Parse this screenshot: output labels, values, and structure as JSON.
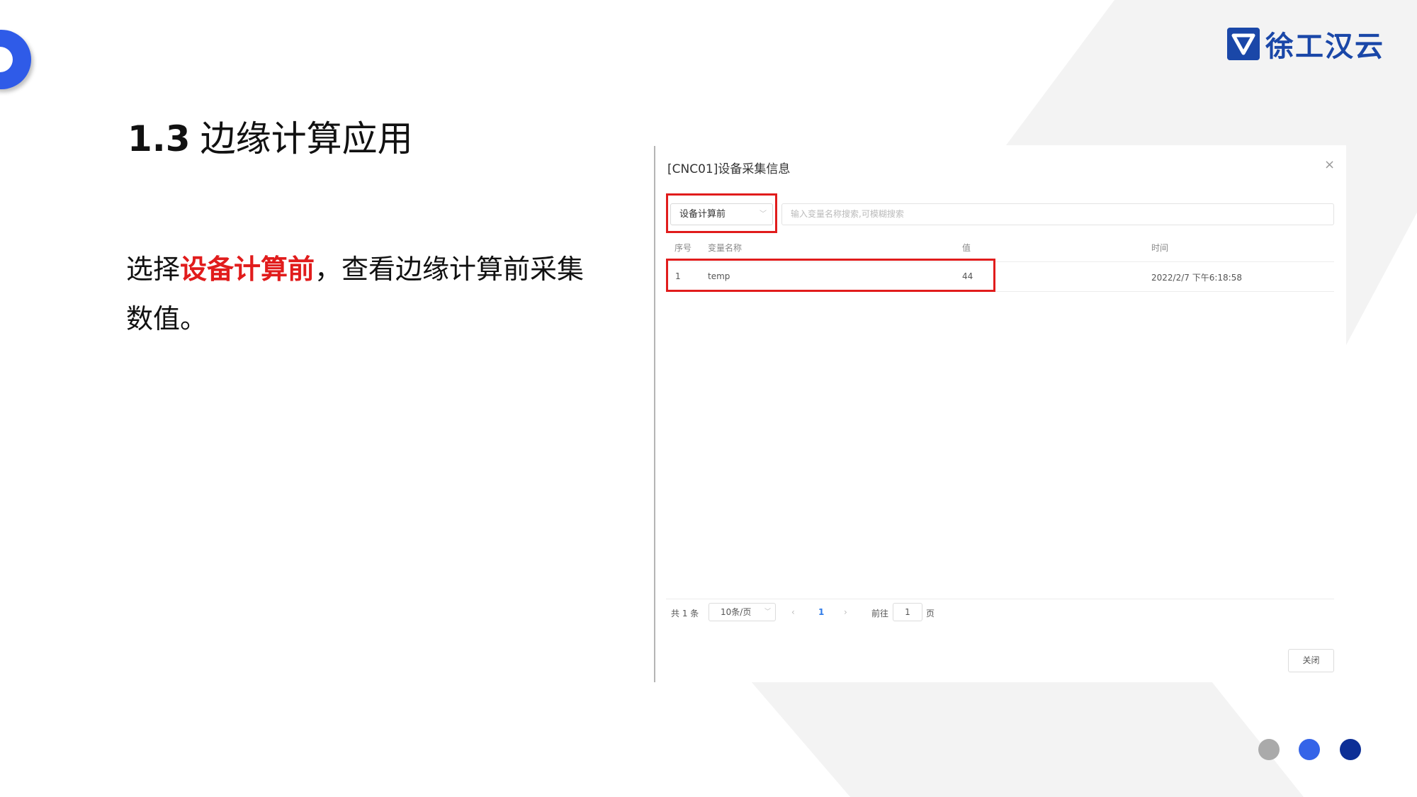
{
  "logo": {
    "text": "徐工汉云",
    "icon": "xcmg-shield-icon"
  },
  "slide": {
    "number": "1.3",
    "title": "边缘计算应用",
    "desc_pre": "选择",
    "desc_highlight": "设备计算前",
    "desc_post": "，查看边缘计算前采集数值。"
  },
  "dialog": {
    "title": "[CNC01]设备采集信息",
    "close_icon": "×",
    "select_value": "设备计算前",
    "search_placeholder": "输入变量名称搜索,可模糊搜索",
    "columns": [
      "序号",
      "变量名称",
      "值",
      "时间"
    ],
    "rows": [
      {
        "index": "1",
        "name": "temp",
        "value": "44",
        "time": "2022/2/7 下午6:18:58"
      }
    ],
    "pager": {
      "total": "共 1 条",
      "page_size": "10条/页",
      "prev": "‹",
      "current": "1",
      "next": "›",
      "goto_label": "前往",
      "goto_value": "1",
      "page_unit": "页"
    },
    "close_button": "关闭"
  },
  "colors": {
    "accent": "#2f5be8",
    "brand": "#1a47a8",
    "highlight": "#e11c1c",
    "dot_gray": "#aaaaaa",
    "dot_blue": "#3564e8",
    "dot_navy": "#0d2f96"
  }
}
